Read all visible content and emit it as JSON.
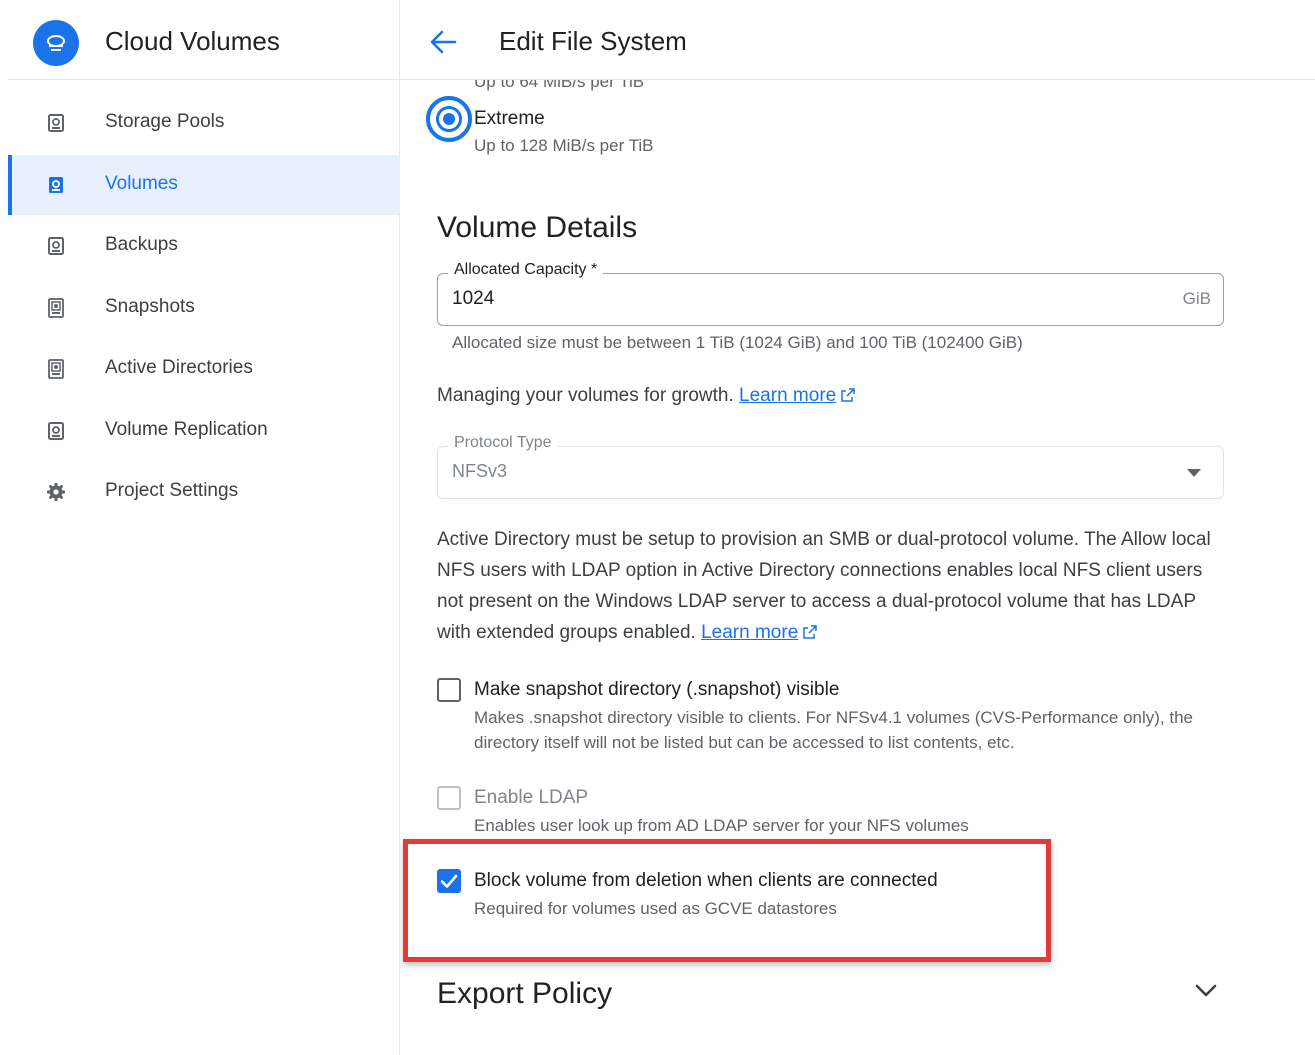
{
  "app": {
    "title": "Cloud Volumes",
    "logo_icon": "cloud-volumes-logo",
    "accent_color": "#1a73e8"
  },
  "sidebar": {
    "items": [
      {
        "label": "Storage Pools",
        "icon": "storage-pool-icon",
        "active": false
      },
      {
        "label": "Volumes",
        "icon": "volume-icon",
        "active": true
      },
      {
        "label": "Backups",
        "icon": "backup-icon",
        "active": false
      },
      {
        "label": "Snapshots",
        "icon": "snapshot-icon",
        "active": false
      },
      {
        "label": "Active Directories",
        "icon": "active-directory-icon",
        "active": false
      },
      {
        "label": "Volume Replication",
        "icon": "replication-icon",
        "active": false
      },
      {
        "label": "Project Settings",
        "icon": "gear-icon",
        "active": false
      }
    ]
  },
  "header": {
    "title": "Edit File System",
    "back_icon": "back-arrow-icon"
  },
  "service_level": {
    "partial_text": "Up to 64 MiB/s per TiB",
    "selected_label": "Extreme",
    "selected_sub": "Up to 128 MiB/s per TiB"
  },
  "volume_details": {
    "heading": "Volume Details",
    "capacity": {
      "label": "Allocated Capacity *",
      "value": "1024",
      "unit": "GiB",
      "hint": "Allocated size must be between 1 TiB (1024 GiB) and 100 TiB (102400 GiB)"
    },
    "growth_text": "Managing your volumes for growth.",
    "growth_link": "Learn more",
    "protocol": {
      "label": "Protocol Type",
      "value": "NFSv3"
    },
    "ad_paragraph": "Active Directory must be setup to provision an SMB or dual-protocol volume. The Allow local NFS users with LDAP option in Active Directory connections enables local NFS client users not present on the Windows LDAP server to access a dual-protocol volume that has LDAP with extended groups enabled.",
    "ad_link": "Learn more"
  },
  "options": {
    "snapshot_dir": {
      "label": "Make snapshot directory (.snapshot) visible",
      "description": "Makes .snapshot directory visible to clients. For NFSv4.1 volumes (CVS-Performance only), the directory itself will not be listed but can be accessed to list contents, etc.",
      "checked": false
    },
    "ldap": {
      "label": "Enable LDAP",
      "description": "Enables user look up from AD LDAP server for your NFS volumes",
      "checked": false,
      "disabled": true
    },
    "block_deletion": {
      "label": "Block volume from deletion when clients are connected",
      "description": "Required for volumes used as GCVE datastores",
      "checked": true
    }
  },
  "export_policy": {
    "heading": "Export Policy",
    "toggle_icon": "chevron-down-icon"
  },
  "highlight_color": "#e53935"
}
